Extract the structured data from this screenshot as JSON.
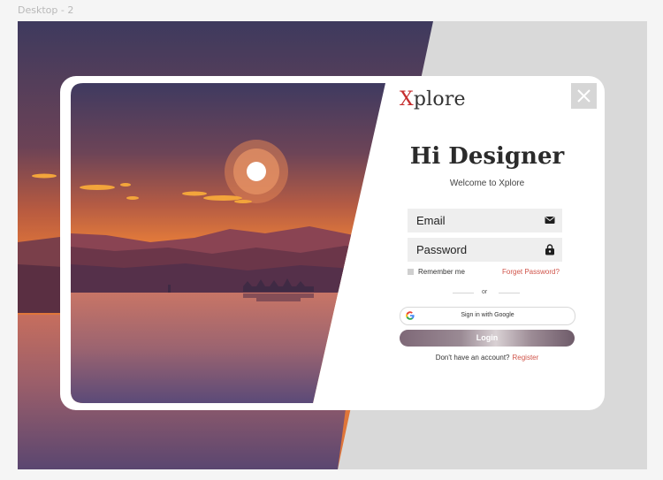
{
  "frame": {
    "label": "Desktop - 2"
  },
  "brand": {
    "logo_x": "X",
    "logo_rest": "plore"
  },
  "login": {
    "title": "Hi Designer",
    "subtitle": "Welcome to Xplore",
    "email_placeholder": "Email",
    "password_placeholder": "Password",
    "remember_label": "Remember me",
    "forgot_label": "Forget Password?",
    "or_label": "or",
    "google_label": "Sign in with Google",
    "login_label": "Login",
    "signup_prompt": "Don't have an account?",
    "register_label": "Register"
  },
  "icons": {
    "close": "close-icon",
    "email": "envelope-icon",
    "password": "lock-icon",
    "google": "google-icon"
  },
  "colors": {
    "accent_red": "#d0544a",
    "logo_red": "#c62e2e",
    "field_bg": "#eeeeee",
    "card_bg": "#ffffff"
  }
}
